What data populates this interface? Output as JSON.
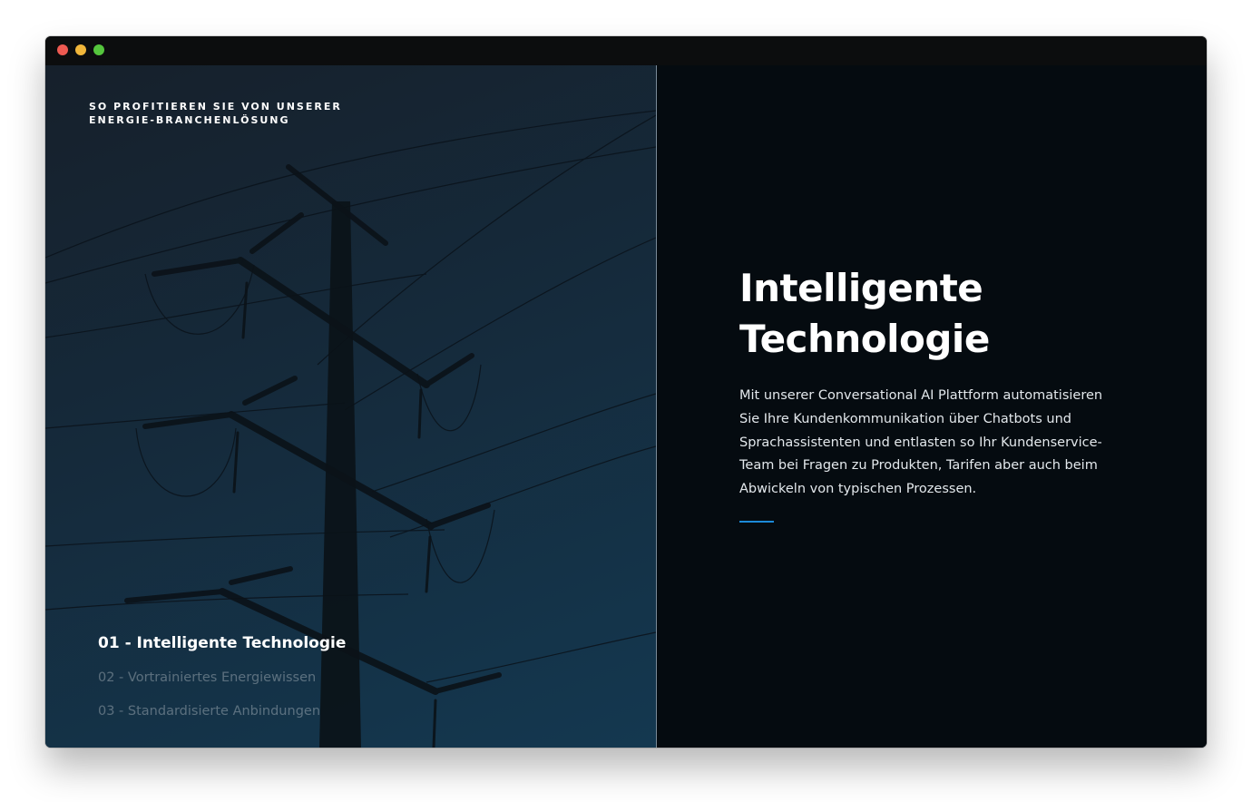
{
  "window": {
    "controls": [
      "close",
      "minimize",
      "maximize"
    ]
  },
  "left_panel": {
    "eyebrow": "SO PROFITIEREN SIE VON UNSERER ENERGIE-BRANCHENLÖSUNG",
    "background_image": "power-line-pylon",
    "steps": [
      {
        "label": "01 - Intelligente Technologie",
        "active": true
      },
      {
        "label": "02 - Vortrainiertes Energiewissen",
        "active": false
      },
      {
        "label": "03 - Standardisierte Anbindungen",
        "active": false
      }
    ]
  },
  "right_panel": {
    "headline": "Intelligente Technologie",
    "body": "Mit unserer Conversational AI Plattform automatisieren Sie Ihre Kundenkommunikation über Chatbots und Sprachassistenten und entlasten so Ihr Kundenservice-Team bei Fragen zu Produkten, Tarifen aber auch beim Abwickeln von typischen Prozessen."
  },
  "colors": {
    "accent": "#1c8ad8",
    "right_background": "#050b10",
    "left_gradient_top": "#16202b",
    "left_gradient_bottom": "#143850"
  }
}
